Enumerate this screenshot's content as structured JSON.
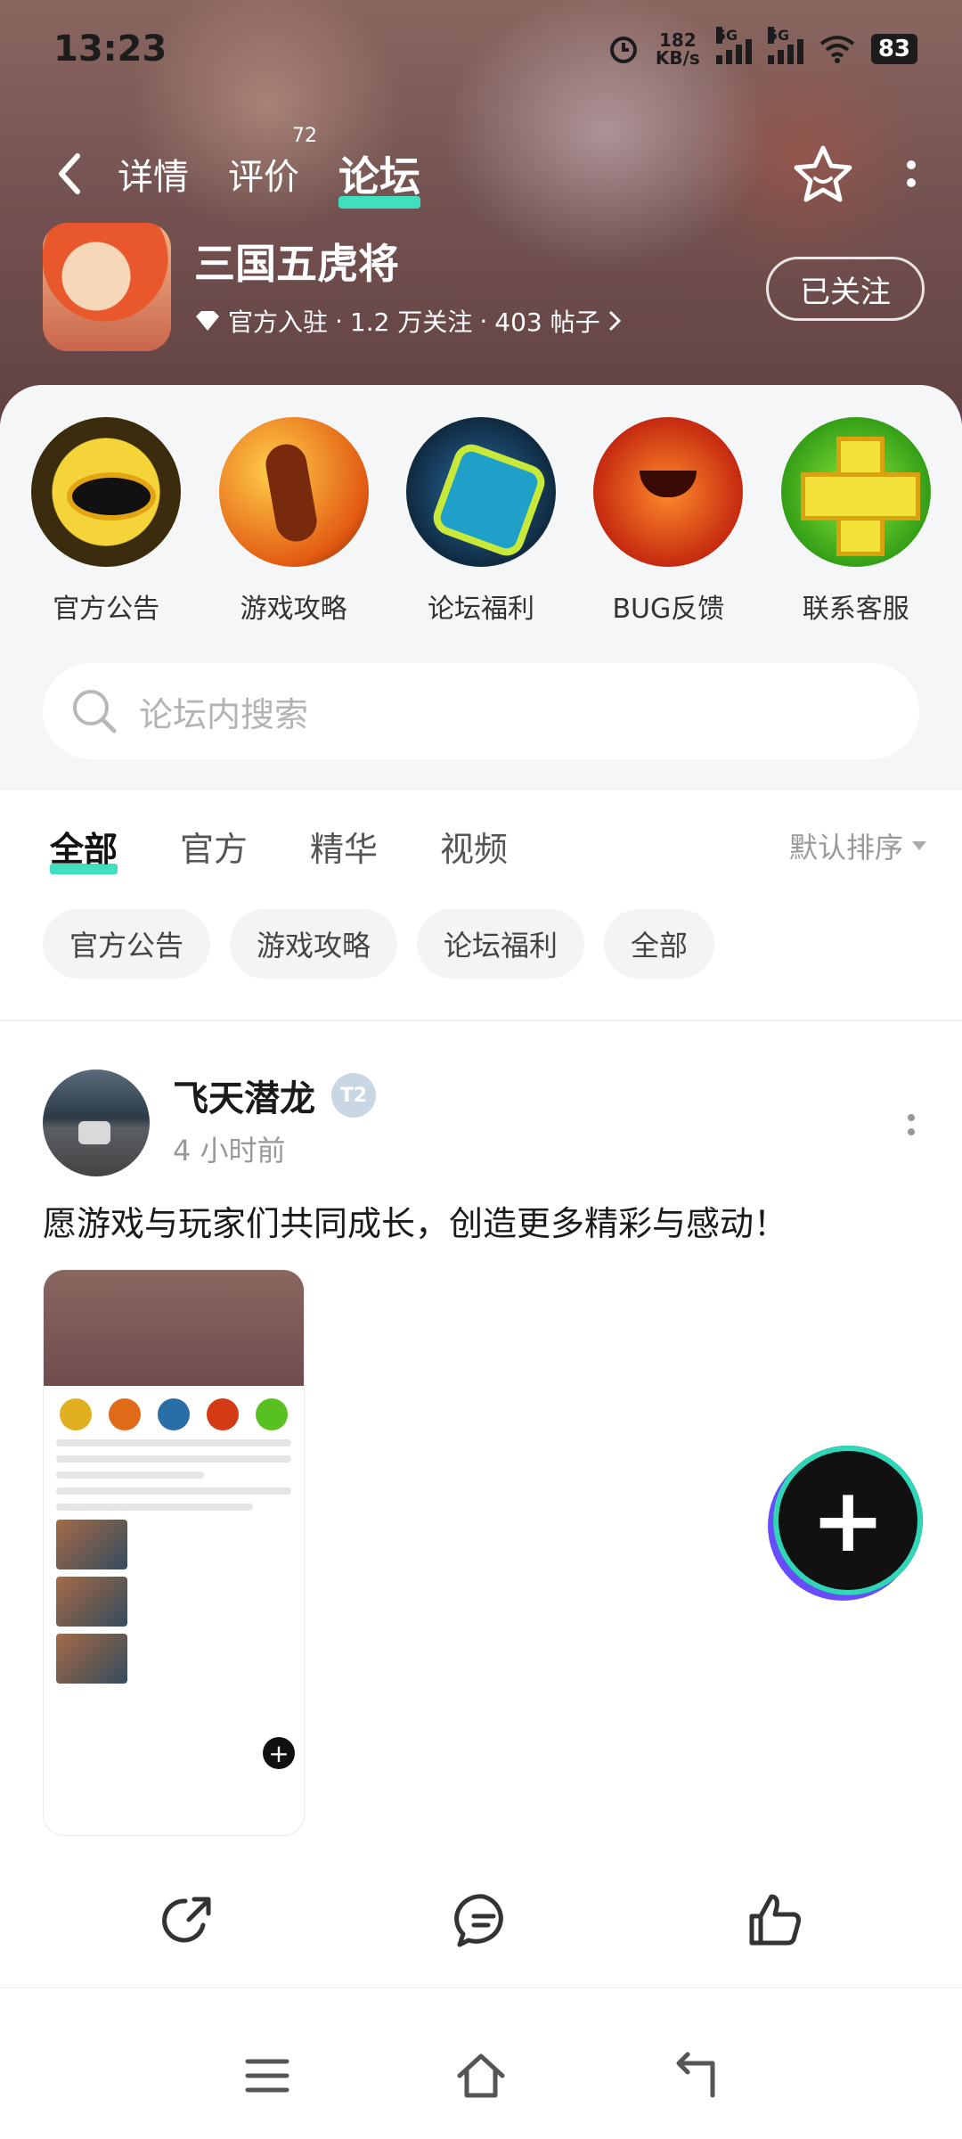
{
  "status_bar": {
    "time": "13:23",
    "net_speed_value": "182",
    "net_speed_unit": "KB/s",
    "sim1": "5G",
    "sim2": "5G",
    "battery": "83"
  },
  "top_tabs": [
    {
      "label": "详情"
    },
    {
      "label": "评价",
      "badge": "72"
    },
    {
      "label": "论坛",
      "active": true
    }
  ],
  "game": {
    "name": "三国五虎将",
    "official": "官方入驻",
    "followers": "1.2 万关注",
    "posts": "403 帖子",
    "follow_button": "已关注"
  },
  "quick_entries": [
    {
      "label": "官方公告",
      "icon": "eye-icon"
    },
    {
      "label": "游戏攻略",
      "icon": "strategy-icon"
    },
    {
      "label": "论坛福利",
      "icon": "gift-icon"
    },
    {
      "label": "BUG反馈",
      "icon": "pumpkin-icon"
    },
    {
      "label": "联系客服",
      "icon": "plus-cross-icon"
    }
  ],
  "search": {
    "placeholder": "论坛内搜索"
  },
  "filter_tabs": [
    {
      "label": "全部",
      "active": true
    },
    {
      "label": "官方"
    },
    {
      "label": "精华"
    },
    {
      "label": "视频"
    }
  ],
  "sort": {
    "label": "默认排序"
  },
  "chips": [
    "官方公告",
    "游戏攻略",
    "论坛福利",
    "全部"
  ],
  "post": {
    "author": "飞天潜龙",
    "level": "2",
    "time": "4 小时前",
    "text": "愿游戏与玩家们共同成长，创造更多精彩与感动！"
  },
  "colors": {
    "accent": "#3fe0c0",
    "banner": "#7b5a58",
    "sheet_bg": "#f5f6f8"
  }
}
